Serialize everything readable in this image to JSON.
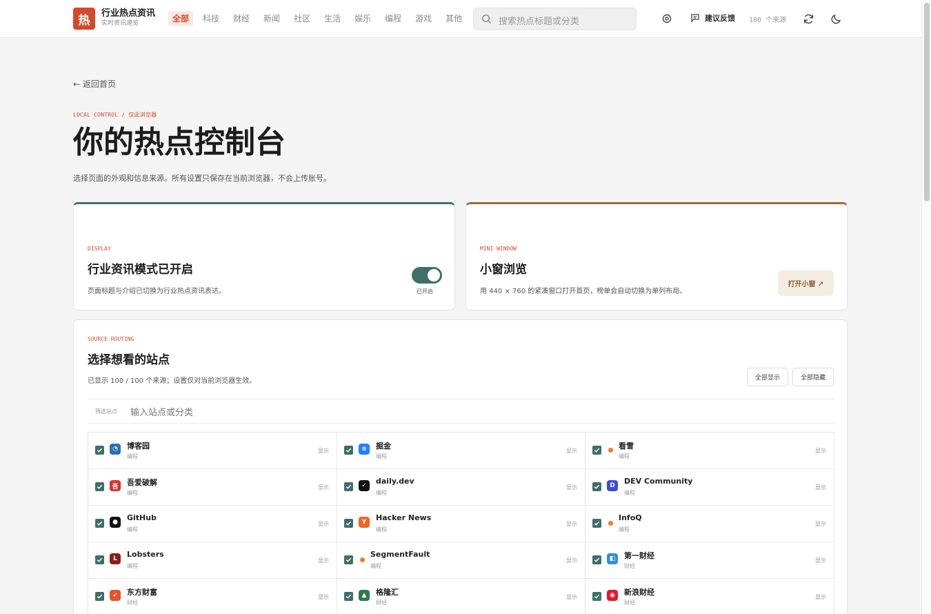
{
  "header": {
    "logo_char": "热",
    "title": "行业热点资讯",
    "subtitle": "实时资讯速览",
    "nav": [
      "全部",
      "科技",
      "财经",
      "新闻",
      "社区",
      "生活",
      "娱乐",
      "编程",
      "游戏",
      "其他"
    ],
    "search_placeholder": "搜索热点标题或分类",
    "feedback_label": "建议反馈",
    "sources_count": "100 个来源"
  },
  "page": {
    "back_link": "← 返回首页",
    "eyebrow": "LOCAL CONTROL / 仅此浏览器",
    "title": "你的热点控制台",
    "description": "选择页面的外观和信息来源。所有设置只保存在当前浏览器，不会上传账号。"
  },
  "display_card": {
    "kicker": "DISPLAY",
    "title": "行业资讯模式已开启",
    "description": "页面标题与介绍已切换为行业热点资讯表达。",
    "toggle_on": true,
    "toggle_label": "已开启",
    "accent": "#3e6f6b"
  },
  "mini_card": {
    "kicker": "MINI WINDOW",
    "title": "小窗浏览",
    "description": "用 440 × 760 的紧凑窗口打开首页，榜单会自动切换为单列布局。",
    "button_label": "打开小窗 ↗",
    "accent": "#9b6a32"
  },
  "sources": {
    "kicker": "SOURCE ROUTING",
    "title": "选择想看的站点",
    "summary": "已显示 100 / 100 个来源；设置仅对当前浏览器生效。",
    "show_all": "全部显示",
    "hide_all": "全部隐藏",
    "filter_label": "筛选站点",
    "filter_placeholder": "输入站点或分类",
    "items": [
      {
        "name": "博客园",
        "category": "编程",
        "state": "显示",
        "checked": true,
        "icon": "cnblogs-icon",
        "color": "#2a6ebb"
      },
      {
        "name": "掘金",
        "category": "编程",
        "state": "显示",
        "checked": true,
        "icon": "juejin-icon",
        "color": "#1e80ff"
      },
      {
        "name": "看雪",
        "category": "编程",
        "state": "显示",
        "checked": true,
        "icon": "dot-icon",
        "color": "#f07a2a"
      },
      {
        "name": "吾爱破解",
        "category": "编程",
        "state": "显示",
        "checked": true,
        "icon": "52pojie-icon",
        "color": "#d8322b"
      },
      {
        "name": "daily.dev",
        "category": "编程",
        "state": "显示",
        "checked": true,
        "icon": "dailydev-icon",
        "color": "#111111"
      },
      {
        "name": "DEV Community",
        "category": "编程",
        "state": "显示",
        "checked": true,
        "icon": "dev-icon",
        "color": "#3b49df"
      },
      {
        "name": "GitHub",
        "category": "编程",
        "state": "显示",
        "checked": true,
        "icon": "github-icon",
        "color": "#111111"
      },
      {
        "name": "Hacker News",
        "category": "编程",
        "state": "显示",
        "checked": true,
        "icon": "hackernews-icon",
        "color": "#f26522"
      },
      {
        "name": "InfoQ",
        "category": "编程",
        "state": "显示",
        "checked": true,
        "icon": "dot-icon",
        "color": "#f07a2a"
      },
      {
        "name": "Lobsters",
        "category": "编程",
        "state": "显示",
        "checked": true,
        "icon": "lobsters-icon",
        "color": "#8e1c1c"
      },
      {
        "name": "SegmentFault",
        "category": "编程",
        "state": "显示",
        "checked": true,
        "icon": "dot-icon",
        "color": "#f07a2a"
      },
      {
        "name": "第一财经",
        "category": "财经",
        "state": "显示",
        "checked": true,
        "icon": "yicai-icon",
        "color": "#2d8fe0"
      },
      {
        "name": "东方财富",
        "category": "财经",
        "state": "显示",
        "checked": true,
        "icon": "eastmoney-icon",
        "color": "#e0562a"
      },
      {
        "name": "格隆汇",
        "category": "财经",
        "state": "显示",
        "checked": true,
        "icon": "gelonghui-icon",
        "color": "#2a7a4d"
      },
      {
        "name": "新浪财经",
        "category": "财经",
        "state": "显示",
        "checked": true,
        "icon": "sina-icon",
        "color": "#e6162d"
      }
    ]
  }
}
